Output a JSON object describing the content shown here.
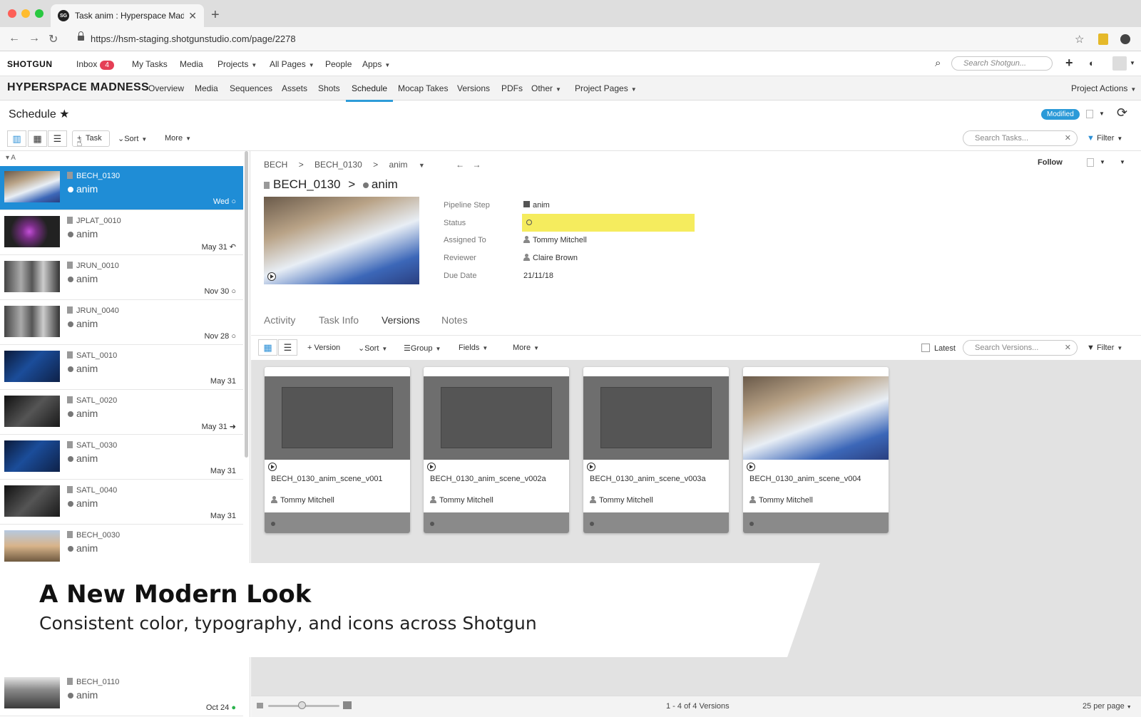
{
  "browser": {
    "tab_title": "Task anim : Hyperspace Madness",
    "favicon_text": "SG",
    "url": "https://hsm-staging.shotgunstudio.com/page/2278"
  },
  "appnav": {
    "logo": "SHOTGUN",
    "inbox_label": "Inbox",
    "inbox_count": "4",
    "items": [
      "My Tasks",
      "Media",
      "Projects",
      "All Pages",
      "People",
      "Apps"
    ],
    "search_placeholder": "Search Shotgun..."
  },
  "project": {
    "name": "HYPERSPACE MADNESS",
    "tabs": [
      "Overview",
      "Media",
      "Sequences",
      "Assets",
      "Shots",
      "Schedule",
      "Mocap Takes",
      "Versions",
      "PDFs",
      "Other",
      "Project Pages"
    ],
    "active_tab": "Schedule",
    "actions_label": "Project Actions"
  },
  "page": {
    "title": "Schedule",
    "modified_badge": "Modified"
  },
  "toolbar": {
    "task_btn": "Task",
    "sort_label": "Sort",
    "more_label": "More",
    "search_placeholder": "Search Tasks...",
    "filter_label": "Filter"
  },
  "tasklist": {
    "group_label": "A",
    "items": [
      {
        "entity": "BECH_0130",
        "task": "anim",
        "date": "Wed"
      },
      {
        "entity": "JPLAT_0010",
        "task": "anim",
        "date": "May 31"
      },
      {
        "entity": "JRUN_0010",
        "task": "anim",
        "date": "Nov 30"
      },
      {
        "entity": "JRUN_0040",
        "task": "anim",
        "date": "Nov 28"
      },
      {
        "entity": "SATL_0010",
        "task": "anim",
        "date": "May 31"
      },
      {
        "entity": "SATL_0020",
        "task": "anim",
        "date": "May 31"
      },
      {
        "entity": "SATL_0030",
        "task": "anim",
        "date": "May 31"
      },
      {
        "entity": "SATL_0040",
        "task": "anim",
        "date": "May 31"
      },
      {
        "entity": "BECH_0030",
        "task": "anim",
        "date": ""
      },
      {
        "entity": "BECH_0110",
        "task": "anim",
        "date": "Oct 24"
      }
    ]
  },
  "detail": {
    "crumb": [
      "BECH",
      "BECH_0130",
      "anim"
    ],
    "title_entity": "BECH_0130",
    "title_task": "anim",
    "follow_label": "Follow",
    "fields": {
      "pipeline_step_label": "Pipeline Step",
      "pipeline_step": "anim",
      "status_label": "Status",
      "assigned_label": "Assigned To",
      "assigned": "Tommy Mitchell",
      "reviewer_label": "Reviewer",
      "reviewer": "Claire Brown",
      "due_label": "Due Date",
      "due": "21/11/18"
    },
    "tabs": [
      "Activity",
      "Task Info",
      "Versions",
      "Notes"
    ],
    "active_tab": "Versions"
  },
  "versions_toolbar": {
    "version_btn": "Version",
    "sort_label": "Sort",
    "group_label": "Group",
    "fields_label": "Fields",
    "more_label": "More",
    "latest_label": "Latest",
    "search_placeholder": "Search Versions...",
    "filter_label": "Filter"
  },
  "versions": [
    {
      "name": "BECH_0130_anim_scene_v001",
      "user": "Tommy Mitchell"
    },
    {
      "name": "BECH_0130_anim_scene_v002a",
      "user": "Tommy Mitchell"
    },
    {
      "name": "BECH_0130_anim_scene_v003a",
      "user": "Tommy Mitchell"
    },
    {
      "name": "BECH_0130_anim_scene_v004",
      "user": "Tommy Mitchell"
    }
  ],
  "footer": {
    "count": "1 - 4 of 4 Versions",
    "per_page": "25 per page"
  },
  "banner": {
    "headline": "A New Modern Look",
    "subline": "Consistent color, typography, and icons across Shotgun"
  },
  "colors": {
    "accent": "#2e9cd8",
    "selected_row": "#1f8dd6",
    "status_yellow": "#f5ec5e",
    "badge_red": "#e53e55"
  }
}
